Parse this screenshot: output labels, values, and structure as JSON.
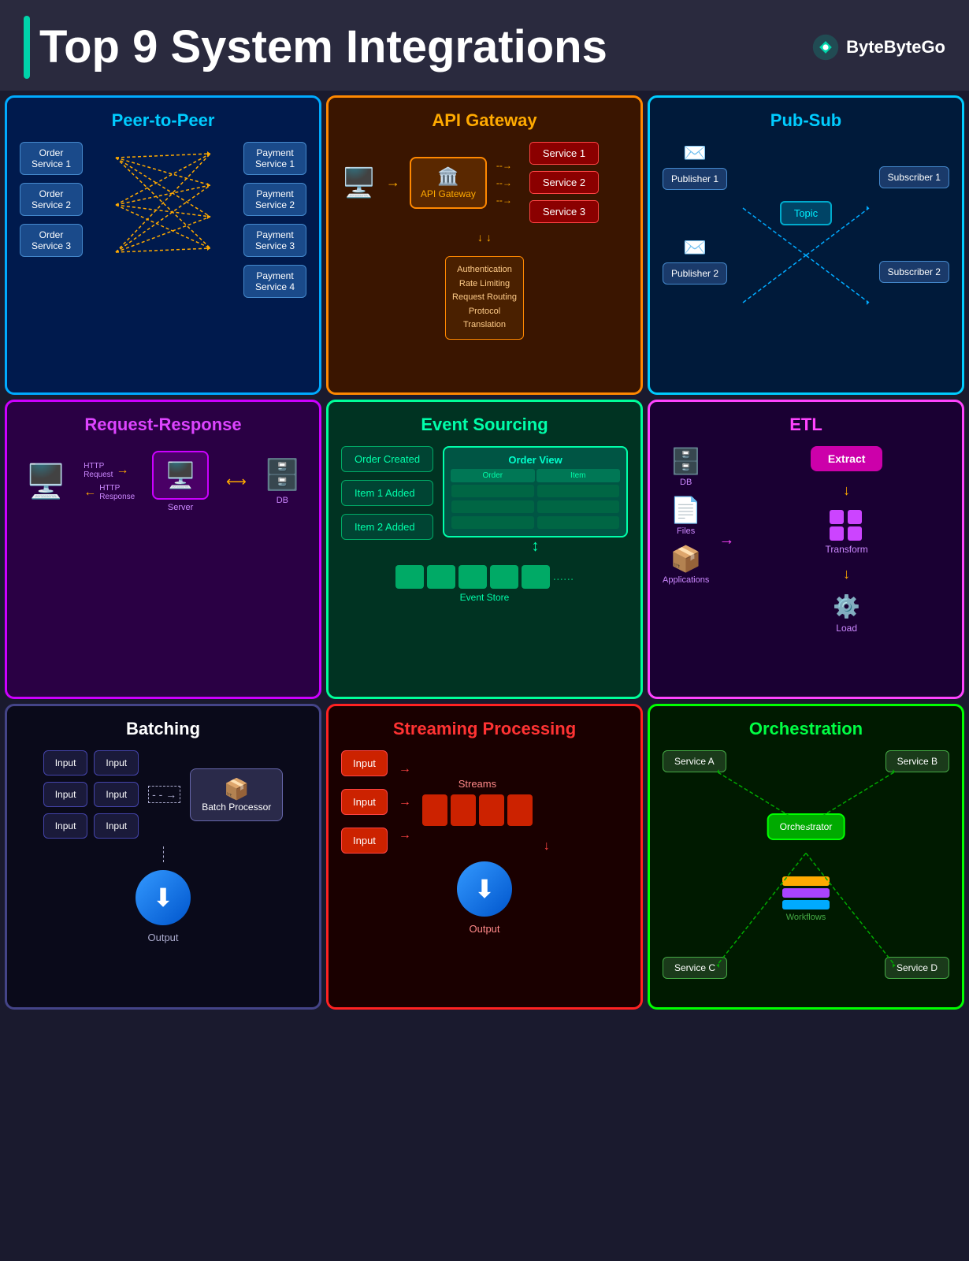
{
  "header": {
    "title": "Top 9 System Integrations",
    "brand": "ByteByteGo"
  },
  "cards": {
    "p2p": {
      "title": "Peer-to-Peer",
      "orders": [
        "Order Service 1",
        "Order Service 2",
        "Order Service 3"
      ],
      "payments": [
        "Payment Service 1",
        "Payment Service 2",
        "Payment Service 3",
        "Payment Service 4"
      ]
    },
    "api": {
      "title": "API Gateway",
      "gateway_label": "API Gateway",
      "gateway_icon": "API",
      "services": [
        "Service 1",
        "Service 2",
        "Service 3"
      ],
      "features": "Authentication\nRate Limiting\nRequest Routing\nProtocol\nTranslation"
    },
    "pubsub": {
      "title": "Pub-Sub",
      "publishers": [
        "Publisher 1",
        "Publisher 2"
      ],
      "subscribers": [
        "Subscriber 1",
        "Subscriber 2"
      ],
      "topic": "Topic"
    },
    "rr": {
      "title": "Request-Response",
      "http_request": "HTTP Request",
      "http_response": "HTTP Response",
      "server": "Server",
      "db": "DB"
    },
    "es": {
      "title": "Event Sourcing",
      "events": [
        "Order Created",
        "Item 1 Added",
        "Item 2 Added"
      ],
      "order_view": "Order View",
      "order_col": "Order",
      "item_col": "Item",
      "event_store": "Event Store"
    },
    "etl": {
      "title": "ETL",
      "sources": [
        "DB",
        "Files",
        "Applications"
      ],
      "steps": [
        "Extract",
        "Transform",
        "Load"
      ]
    },
    "batch": {
      "title": "Batching",
      "inputs": [
        "Input",
        "Input",
        "Input",
        "Input",
        "Input",
        "Input"
      ],
      "processor": "Batch Processor",
      "output": "Output"
    },
    "stream": {
      "title": "Streaming Processing",
      "inputs": [
        "Input",
        "Input",
        "Input"
      ],
      "streams": "Streams",
      "output": "Output"
    },
    "orch": {
      "title": "Orchestration",
      "services": [
        "Service A",
        "Service B",
        "Service C",
        "Service D"
      ],
      "orchestrator": "Orchestrator",
      "workflows": "Workflows"
    }
  }
}
